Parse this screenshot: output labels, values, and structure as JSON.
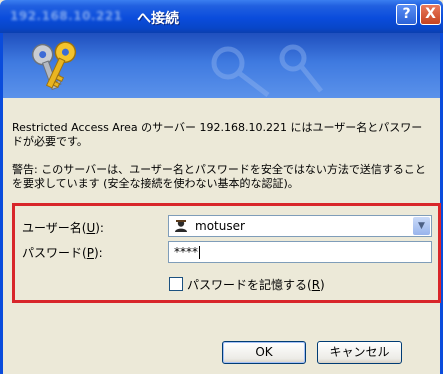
{
  "window": {
    "title_ip": "192.168.10.221",
    "title_suffix": "へ接続",
    "help_label": "?",
    "close_label": "X"
  },
  "message": {
    "line1": "Restricted Access Area のサーバー 192.168.10.221 にはユーザー名とパスワードが必要です。",
    "line2": "警告: このサーバーは、ユーザー名とパスワードを安全ではない方法で送信することを要求しています (安全な接続を使わない基本的な認証)。"
  },
  "form": {
    "username_label": "ユーザー名(",
    "username_key": "U",
    "username_label_end": "):",
    "username_value": "motuser",
    "password_label": "パスワード(",
    "password_key": "P",
    "password_label_end": "):",
    "password_value": "****",
    "remember_label": "パスワードを記憶する(",
    "remember_key": "R",
    "remember_label_end": ")",
    "remember_checked": false
  },
  "buttons": {
    "ok": "OK",
    "cancel": "キャンセル"
  },
  "colors": {
    "titlebar": "#0a4cdc",
    "highlight_box": "#d8262a",
    "dialog_bg": "#ece9d8"
  },
  "icons": [
    "keys-icon",
    "user-icon",
    "dropdown-arrow-icon",
    "help-icon",
    "close-icon"
  ]
}
